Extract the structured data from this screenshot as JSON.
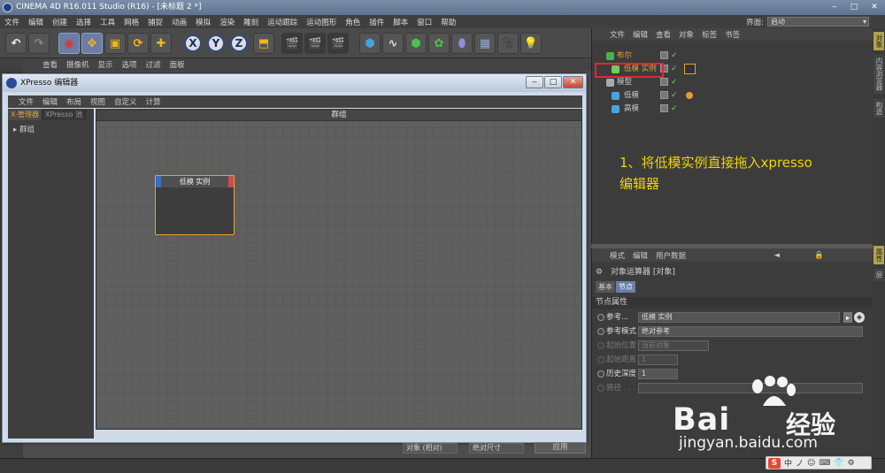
{
  "window": {
    "title": "CINEMA 4D R16.011 Studio (R16) - [未标题 2 *]"
  },
  "menubar": {
    "items": [
      "文件",
      "编辑",
      "创建",
      "选择",
      "工具",
      "网格",
      "捕捉",
      "动画",
      "模拟",
      "渲染",
      "雕刻",
      "运动跟踪",
      "运动图形",
      "角色",
      "插件",
      "脚本",
      "窗口",
      "帮助"
    ],
    "layout_label": "界面:",
    "layout_value": "启动"
  },
  "viewport": {
    "menu": [
      "查看",
      "摄像机",
      "显示",
      "选项",
      "过滤",
      "面板"
    ]
  },
  "xpresso": {
    "title": "XPresso 编辑器",
    "menu": [
      "文件",
      "编辑",
      "布局",
      "视图",
      "自定义",
      "计算"
    ],
    "tabs": [
      "X-管理器",
      "XPresso 池"
    ],
    "tree_item": "群组",
    "canvas_title": "群组",
    "node_title": "低模 实例"
  },
  "objects": {
    "menu": [
      "文件",
      "编辑",
      "查看",
      "对象",
      "标签",
      "书签"
    ],
    "rows": [
      {
        "name": "布尔"
      },
      {
        "name": "低模 实例"
      },
      {
        "name": "模型"
      },
      {
        "name": "低模"
      },
      {
        "name": "高模"
      }
    ]
  },
  "annotation": {
    "line1": "1、将低模实例直接拖入xpresso",
    "line2": "编辑器"
  },
  "right_tabs": [
    "对象",
    "内容浏览器",
    "构造",
    "属性",
    "层"
  ],
  "attributes": {
    "menu": [
      "模式",
      "编辑",
      "用户数据"
    ],
    "header": "对象运算器 [对象]",
    "tabs": [
      "基本",
      "节点"
    ],
    "section": "节点属性",
    "rows": [
      {
        "label": "参考...",
        "value": "低模 实例"
      },
      {
        "label": "参考模式",
        "value": "绝对参考"
      },
      {
        "label": "起始位置",
        "value": "当前对象"
      },
      {
        "label": "起始距离",
        "value": "1"
      },
      {
        "label": "历史深度",
        "value": "1"
      },
      {
        "label": "路径 . . .",
        "value": ""
      }
    ]
  },
  "statusbar": {
    "select1": "对象 (相对)",
    "select2": "绝对尺寸",
    "apply": "应用"
  },
  "watermark": {
    "brand": "Bai",
    "brand_cn": "经验",
    "url": "jingyan.baidu.com"
  },
  "ime": {
    "items": [
      "中",
      "ノ",
      "☺",
      "⌨",
      "👕",
      "⚙"
    ]
  }
}
